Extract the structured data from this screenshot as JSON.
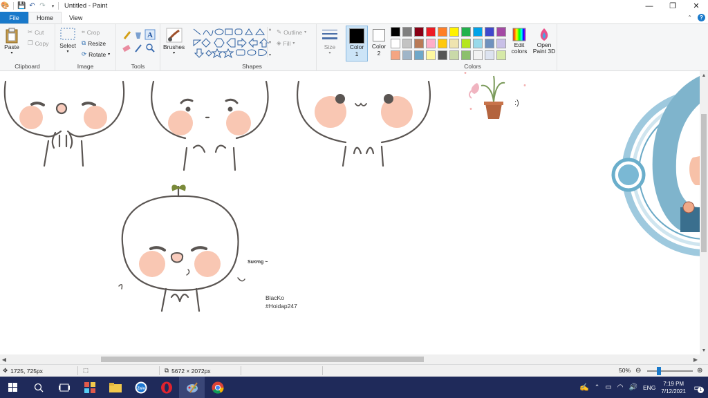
{
  "window": {
    "title": "Untitled - Paint",
    "controls": {
      "minimize": "—",
      "maximize": "❐",
      "close": "✕"
    }
  },
  "tabs": [
    {
      "label": "File"
    },
    {
      "label": "Home"
    },
    {
      "label": "View"
    }
  ],
  "ribbon": {
    "clipboard": {
      "group_label": "Clipboard",
      "paste": "Paste",
      "cut": "Cut",
      "copy": "Copy"
    },
    "image": {
      "group_label": "Image",
      "select": "Select",
      "crop": "Crop",
      "resize": "Resize",
      "rotate": "Rotate"
    },
    "tools": {
      "group_label": "Tools"
    },
    "brushes": {
      "label": "Brushes"
    },
    "shapes": {
      "group_label": "Shapes",
      "outline": "Outline",
      "fill": "Fill"
    },
    "size": {
      "label": "Size"
    },
    "color1": {
      "label": "Color",
      "index": "1"
    },
    "color2": {
      "label": "Color",
      "index": "2"
    },
    "colors": {
      "group_label": "Colors",
      "edit_colors": "Edit colors",
      "swatches": [
        "#000000",
        "#7f7f7f",
        "#880015",
        "#ed1c24",
        "#ff7f27",
        "#fff200",
        "#22b14c",
        "#00a2e8",
        "#3f48cc",
        "#a349a4",
        "#ffffff",
        "#c3c3c3",
        "#b97a57",
        "#ffaec9",
        "#ffc90e",
        "#efe4b0",
        "#b5e61d",
        "#99d9ea",
        "#7092be",
        "#c8bfe7",
        "#f4a582",
        "#9fb5c8",
        "#6fa8c9",
        "#fff8a0",
        "#555555",
        "#c9d9a8",
        "#8cc06c",
        "#f2f2f2",
        "#dde3f0",
        "#d6e9a8"
      ]
    },
    "paint3d": "Open Paint 3D"
  },
  "canvas": {
    "texts": {
      "suong": "Sương ~",
      "signature_line1": "BlacKo",
      "signature_line2": "#Hoidap247"
    }
  },
  "statusbar": {
    "cursor_pos": "1725, 725px",
    "image_size": "5672 × 2072px",
    "zoom": "50%"
  },
  "taskbar": {
    "lang": "ENG",
    "time": "7:19 PM",
    "date": "7/12/2021",
    "notifications": "1"
  }
}
